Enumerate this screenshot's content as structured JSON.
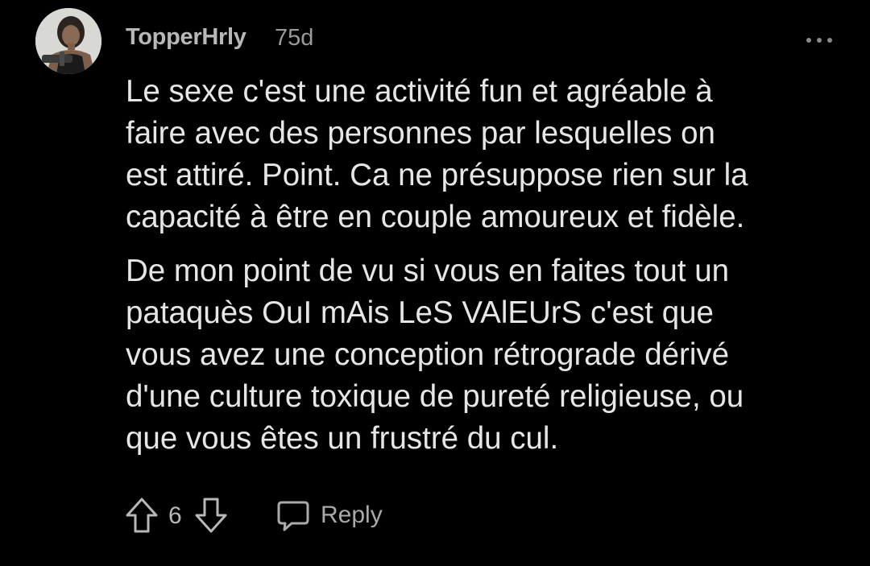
{
  "comment": {
    "author": "TopperHrly",
    "age": "75d",
    "avatar_icon": "user-avatar-photo",
    "more_icon": "more-options-icon",
    "paragraphs": [
      "Le sexe c'est une activité fun et agréable à\nfaire avec des personnes par lesquelles on\nest attiré. Point. Ca ne présuppose rien sur la\ncapacité à être en couple amoureux et fidèle.",
      "De mon point de vu si vous en faites tout un\npataquès OuI mAis LeS VAlEUrS c'est que\nvous avez une conception rétrograde dérivé\nd'une culture toxique de pureté religieuse, ou\nque vous êtes un frustré du cul."
    ],
    "actions": {
      "upvote_icon": "upvote-arrow-icon",
      "vote_count": "6",
      "downvote_icon": "downvote-arrow-icon",
      "reply_icon": "speech-bubble-icon",
      "reply_label": "Reply"
    }
  },
  "colors": {
    "background": "#000000",
    "text": "#e6e6e6",
    "muted": "#9a9a9a"
  }
}
